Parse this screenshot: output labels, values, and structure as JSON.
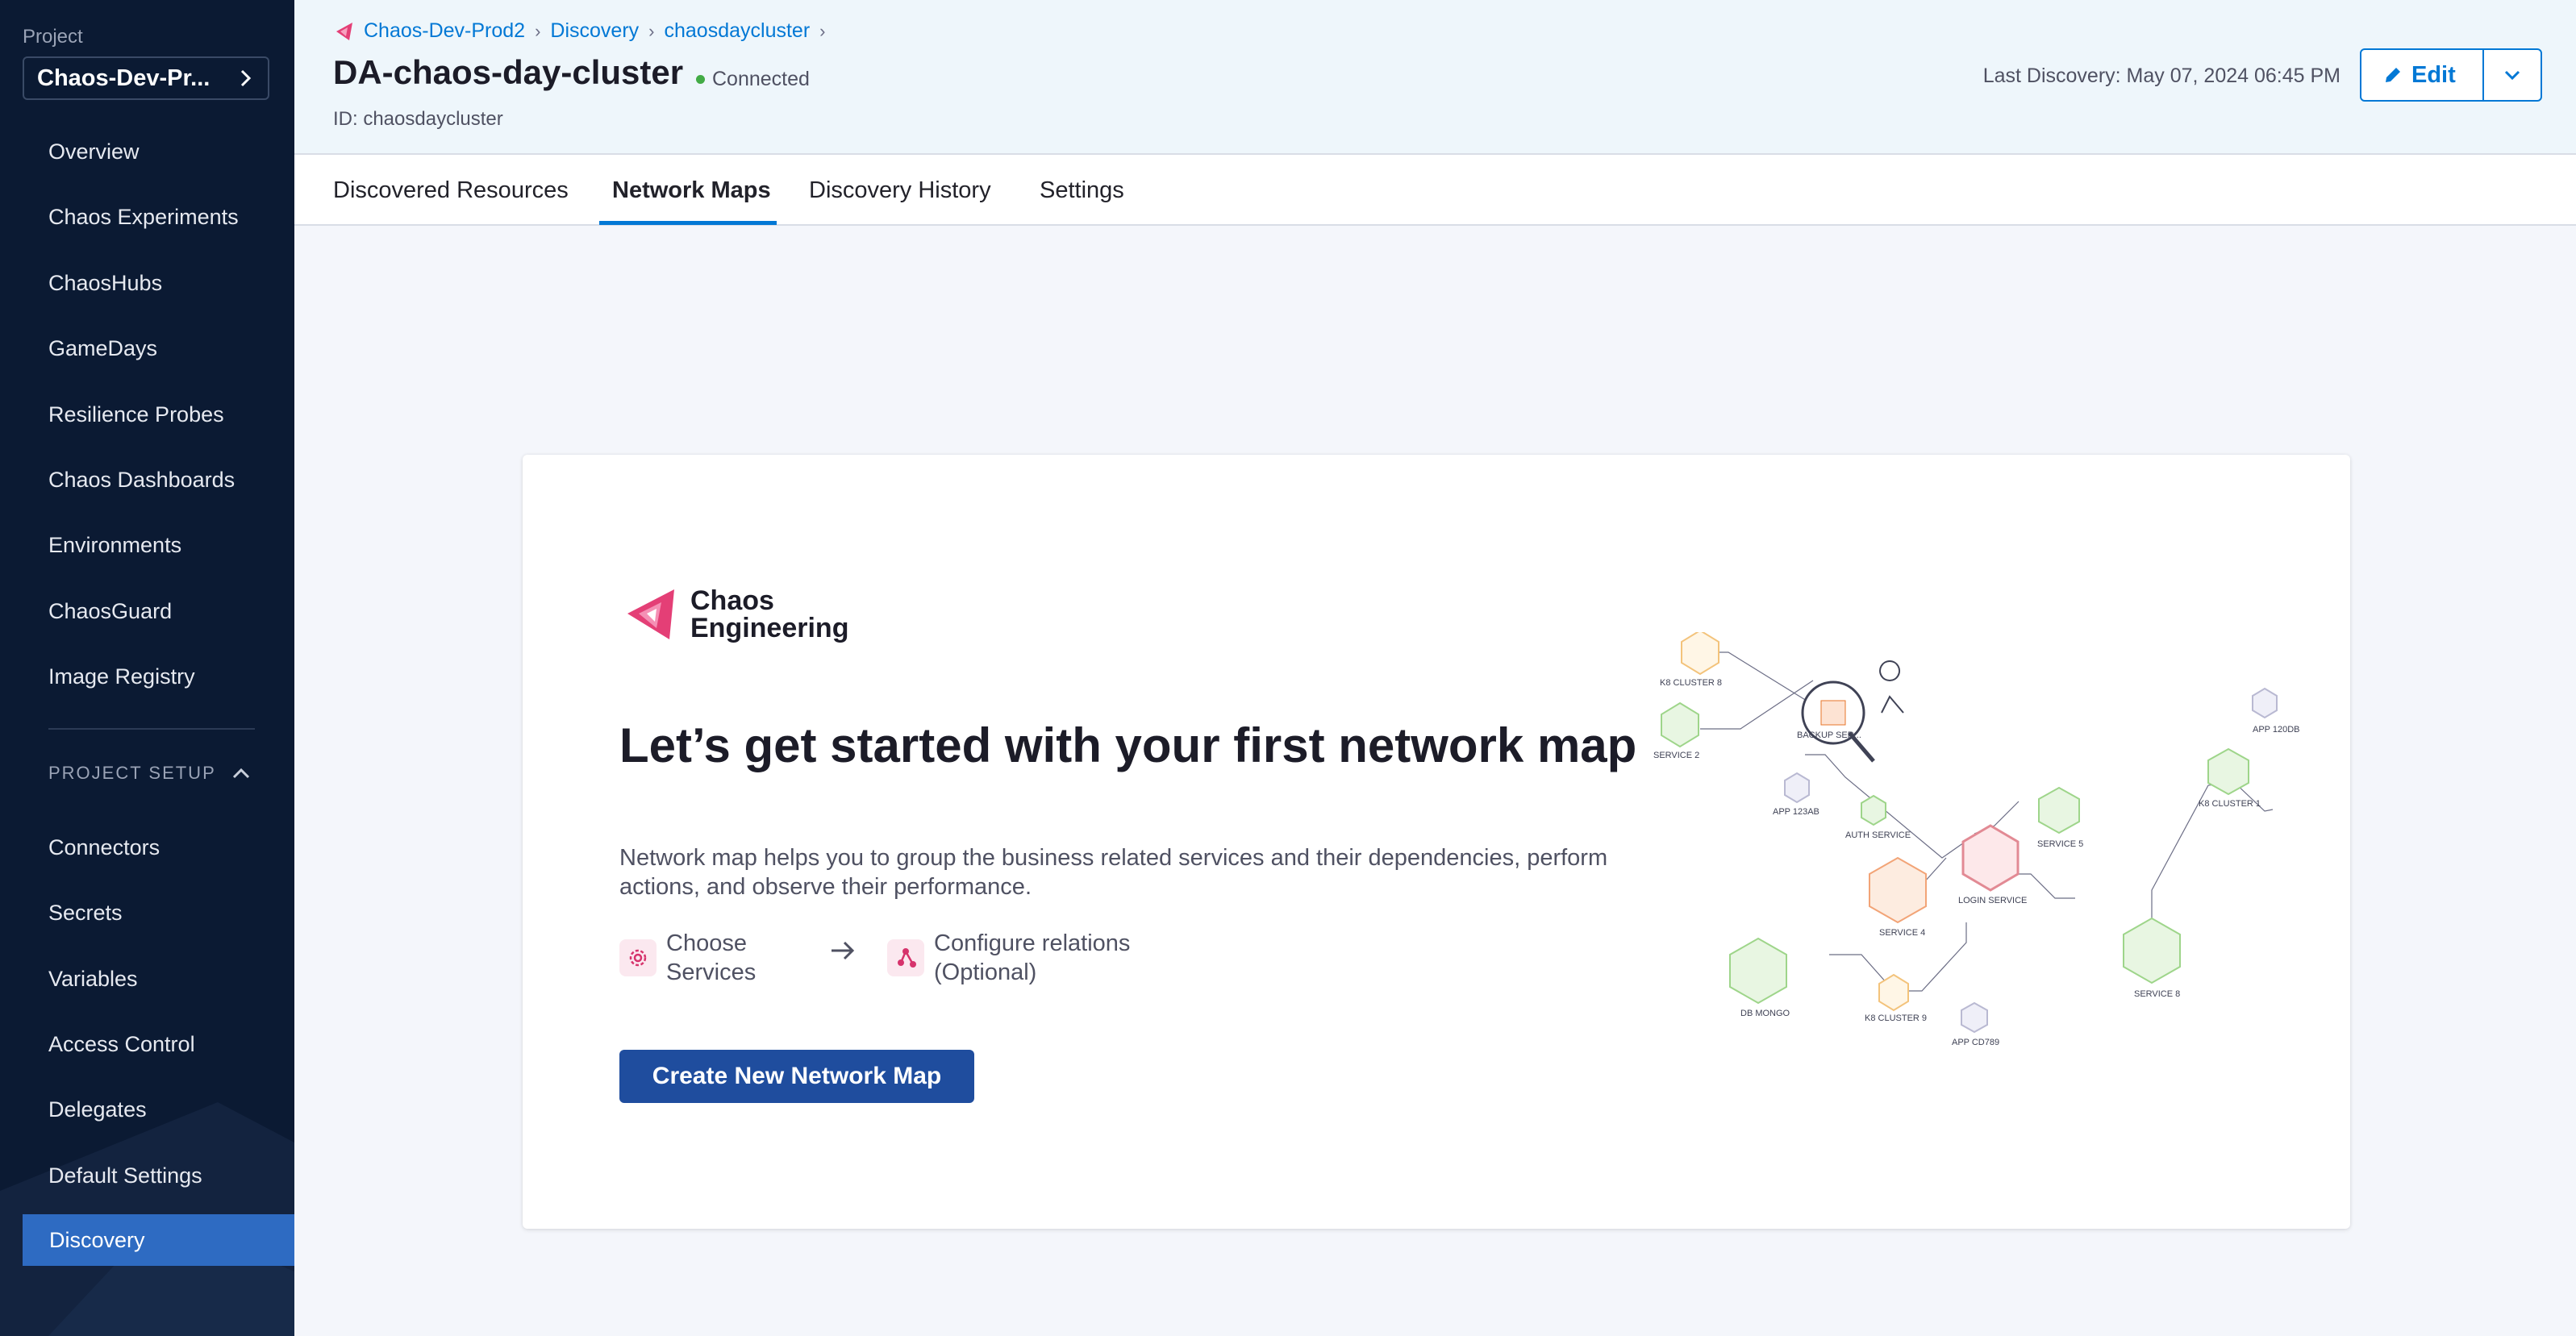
{
  "sidebar": {
    "project_label": "Project",
    "project_name": "Chaos-Dev-Pr...",
    "items": [
      {
        "label": "Overview"
      },
      {
        "label": "Chaos Experiments"
      },
      {
        "label": "ChaosHubs"
      },
      {
        "label": "GameDays"
      },
      {
        "label": "Resilience Probes"
      },
      {
        "label": "Chaos Dashboards"
      },
      {
        "label": "Environments"
      },
      {
        "label": "ChaosGuard"
      },
      {
        "label": "Image Registry"
      }
    ],
    "setup_label": "PROJECT SETUP",
    "setup_items": [
      {
        "label": "Connectors"
      },
      {
        "label": "Secrets"
      },
      {
        "label": "Variables"
      },
      {
        "label": "Access Control"
      },
      {
        "label": "Delegates"
      },
      {
        "label": "Default Settings"
      },
      {
        "label": "Discovery"
      }
    ],
    "active_item": "Discovery"
  },
  "header": {
    "breadcrumb": [
      "Chaos-Dev-Prod2",
      "Discovery",
      "chaosdaycluster"
    ],
    "title": "DA-chaos-day-cluster",
    "status": "Connected",
    "id_line": "ID: chaosdaycluster",
    "last_discovery": "Last Discovery: May 07, 2024 06:45 PM",
    "edit_label": "Edit"
  },
  "tabs": [
    {
      "label": "Discovered Resources"
    },
    {
      "label": "Network Maps"
    },
    {
      "label": "Discovery History"
    },
    {
      "label": "Settings"
    }
  ],
  "active_tab": "Network Maps",
  "empty_state": {
    "brand_line1": "Chaos",
    "brand_line2": "Engineering",
    "headline": "Let’s get started with your first network map",
    "description": "Network map helps you to group the business related services and their dependencies, perform actions, and observe their performance.",
    "step1_line1": "Choose",
    "step1_line2": "Services",
    "step2_line1": "Configure relations",
    "step2_line2": "(Optional)",
    "cta_label": "Create New Network Map"
  },
  "illustration": {
    "nodes": [
      "K8 CLUSTER 8",
      "BACKUP SER...",
      "SERVICE 2",
      "APP 123AB",
      "AUTH SERVICE",
      "SERVICE 5",
      "LOGIN SERVICE",
      "SERVICE 4",
      "SERVICE 8",
      "DB MONGO",
      "K8 CLUSTER 9",
      "APP CD789",
      "K8 CLUSTER 1",
      "APP 120DB"
    ]
  },
  "colors": {
    "sidebar_bg": "#0b1a33",
    "active_nav": "#2e6bc2",
    "accent": "#0278d5",
    "cta": "#1f4d9e",
    "brand_pink": "#e43f76",
    "connected": "#42ab45"
  }
}
